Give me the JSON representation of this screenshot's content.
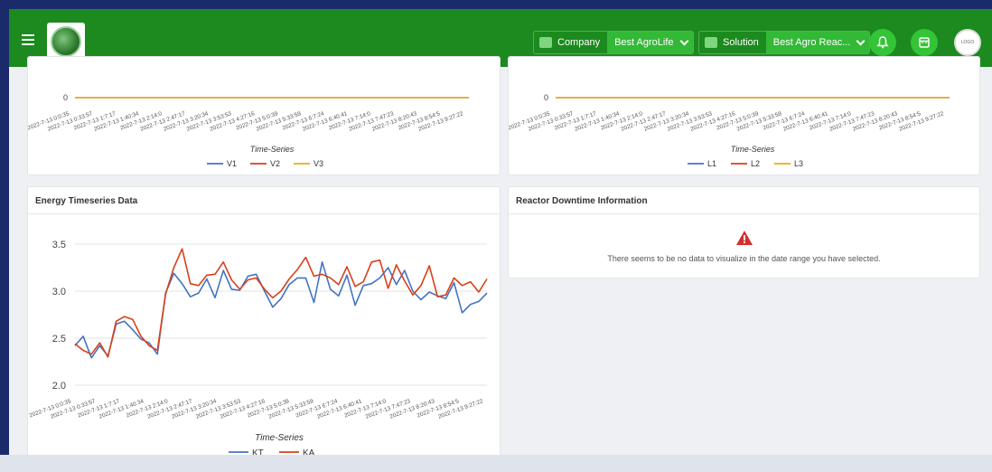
{
  "header": {
    "company_label": "Company",
    "company_value": "Best AgroLife",
    "solution_label": "Solution",
    "solution_value": "Best Agro Reac...",
    "avatar_text": "LOGO"
  },
  "colors": {
    "topbar": "#1c8a1e",
    "accent": "#34b837",
    "series_blue": "#4472c4",
    "series_red": "#d9401a",
    "series_orange": "#f0a818",
    "warning": "#d32f2f"
  },
  "icons": [
    "menu-icon",
    "company-logo",
    "building-icon",
    "folder-icon",
    "chevron-down-icon",
    "bell-icon",
    "store-icon",
    "warning-icon"
  ],
  "time_labels": [
    "2022-7-13 0:0:35",
    "2022-7-13 0:33:57",
    "2022-7-13 1:7:17",
    "2022-7-13 1:40:34",
    "2022-7-13 2:14:0",
    "2022-7-13 2:47:17",
    "2022-7-13 3:20:34",
    "2022-7-13 3:53:53",
    "2022-7-13 4:27:16",
    "2022-7-13 5:0:39",
    "2022-7-13 5:33:59",
    "2022-7-13 6:7:24",
    "2022-7-13 6:40:41",
    "2022-7-13 7:14:0",
    "2022-7-13 7:47:23",
    "2022-7-13 8:20:43",
    "2022-7-13 8:54:5",
    "2022-7-13 9:27:22"
  ],
  "voltage_card": {
    "xlabel": "Time-Series",
    "zero_tick": "0",
    "legend": [
      "V1",
      "V2",
      "V3"
    ]
  },
  "current_card": {
    "xlabel": "Time-Series",
    "zero_tick": "0",
    "legend": [
      "L1",
      "L2",
      "L3"
    ]
  },
  "energy_card": {
    "title": "Energy Timeseries Data"
  },
  "downtime_card": {
    "title": "Reactor Downtime Information",
    "message": "There seems to be no data to visualize in the date range you have selected."
  },
  "chart_data": [
    {
      "type": "line",
      "xlabel": "Time-Series",
      "ylabel": "",
      "ylim": [
        0,
        0
      ],
      "legend_position": "bottom",
      "series": [
        {
          "name": "V1",
          "values": [
            0
          ]
        },
        {
          "name": "V2",
          "values": [
            0
          ]
        },
        {
          "name": "V3",
          "values": [
            0
          ]
        }
      ]
    },
    {
      "type": "line",
      "xlabel": "Time-Series",
      "ylabel": "",
      "ylim": [
        0,
        0
      ],
      "legend_position": "bottom",
      "series": [
        {
          "name": "L1",
          "values": [
            0
          ]
        },
        {
          "name": "L2",
          "values": [
            0
          ]
        },
        {
          "name": "L3",
          "values": [
            0
          ]
        }
      ]
    },
    {
      "type": "line",
      "title": "Energy Timeseries Data",
      "xlabel": "Time-Series",
      "ylabel": "",
      "ylim": [
        2.0,
        3.5
      ],
      "yticks": [
        "3.5",
        "3.0",
        "2.5",
        "2.0"
      ],
      "grid": true,
      "legend_position": "bottom",
      "series": [
        {
          "name": "KT",
          "values": [
            2.42,
            2.52,
            2.29,
            2.42,
            2.31,
            2.65,
            2.68,
            2.59,
            2.49,
            2.45,
            2.33,
            2.98,
            3.19,
            3.08,
            2.94,
            2.98,
            3.13,
            2.93,
            3.22,
            3.02,
            3.01,
            3.16,
            3.18,
            3.0,
            2.83,
            2.92,
            3.07,
            3.14,
            3.14,
            2.88,
            3.31,
            3.02,
            2.95,
            3.17,
            2.85,
            3.06,
            3.08,
            3.14,
            3.25,
            3.07,
            3.22,
            3.0,
            2.91,
            2.99,
            2.95,
            2.92,
            3.09,
            2.77,
            2.86,
            2.89,
            2.98
          ]
        },
        {
          "name": "KA",
          "values": [
            2.44,
            2.37,
            2.33,
            2.45,
            2.3,
            2.68,
            2.73,
            2.7,
            2.52,
            2.42,
            2.37,
            2.97,
            3.25,
            3.45,
            3.08,
            3.06,
            3.17,
            3.18,
            3.31,
            3.12,
            3.02,
            3.12,
            3.14,
            3.02,
            2.93,
            3.0,
            3.13,
            3.23,
            3.36,
            3.16,
            3.18,
            3.14,
            3.07,
            3.26,
            3.05,
            3.1,
            3.31,
            3.33,
            3.03,
            3.28,
            3.11,
            2.96,
            3.06,
            3.27,
            2.94,
            2.96,
            3.14,
            3.06,
            3.1,
            2.99,
            3.13
          ]
        }
      ]
    }
  ]
}
